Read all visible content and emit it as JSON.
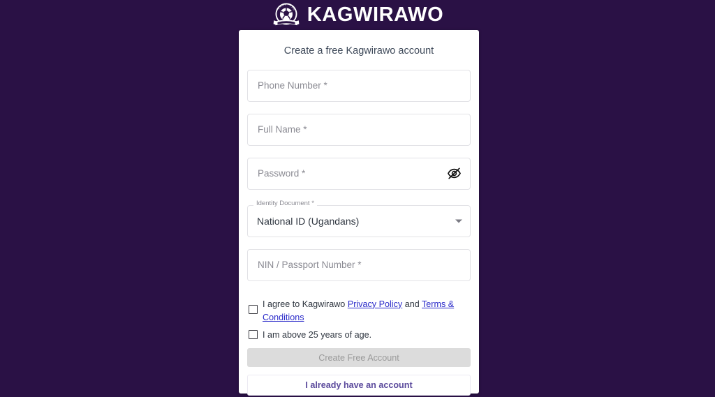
{
  "brand": {
    "name": "KAGWIRAWO",
    "logo_icon": "kagwirawo-crest-icon",
    "logo_arc_text": "KAGWIRAWO"
  },
  "colors": {
    "page_background": "#2a1145",
    "card_background": "#ffffff",
    "link": "#2b2bc9",
    "accent_purple": "#5b4a9c",
    "disabled_button": "#dcdcdc",
    "disabled_button_text": "#9a9a9a",
    "placeholder_text": "#8b8b93"
  },
  "card": {
    "title": "Create a free Kagwirawo account",
    "fields": [
      {
        "name": "phone-number",
        "placeholder": "Phone Number *",
        "value": ""
      },
      {
        "name": "full-name",
        "placeholder": "Full Name *",
        "value": ""
      },
      {
        "name": "password",
        "placeholder": "Password *",
        "value": "",
        "action_icon": "eye-off-icon"
      },
      {
        "name": "nin-passport-number",
        "placeholder": "NIN / Passport Number *",
        "value": ""
      }
    ],
    "identity_document": {
      "label": "Identity Document *",
      "value": "National ID (Ugandans)",
      "arrow_icon": "chevron-down-icon"
    },
    "agreements": [
      {
        "name": "terms-agreement",
        "checked": false,
        "text_prefix": "I agree to Kagwirawo ",
        "link_one": "Privacy Policy",
        "text_middle": " and ",
        "link_two": "Terms & Conditions"
      },
      {
        "name": "age-confirmation",
        "checked": false,
        "text": "I am above 25 years of age."
      }
    ],
    "buttons": {
      "submit": "Create Free Account",
      "submit_disabled": true,
      "secondary": "I already have an account"
    }
  }
}
